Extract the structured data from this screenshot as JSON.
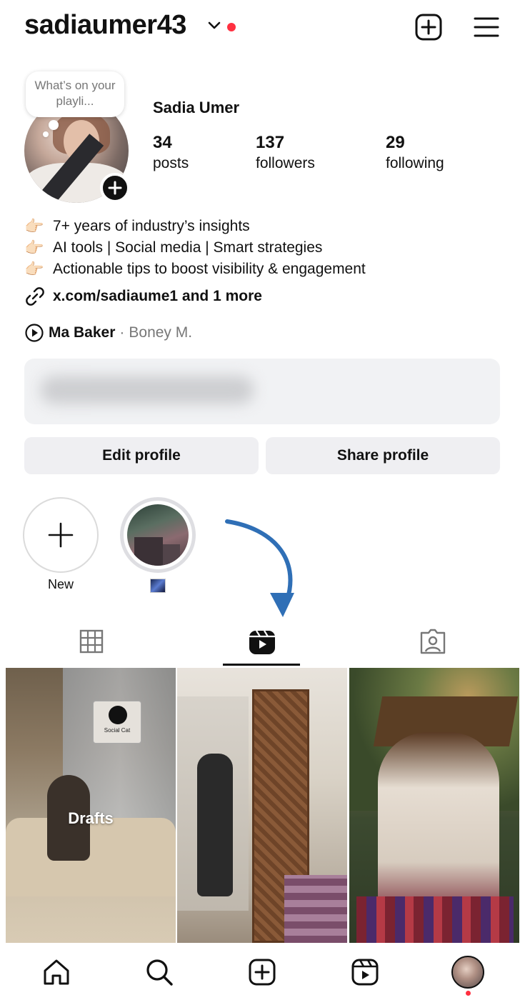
{
  "header": {
    "username": "sadiaumer43"
  },
  "profile": {
    "note": "What’s on your playli...",
    "display_name": "Sadia Umer",
    "stats": [
      {
        "value": "34",
        "label": "posts"
      },
      {
        "value": "137",
        "label": "followers"
      },
      {
        "value": "29",
        "label": "following"
      }
    ],
    "bio": [
      "7+ years of industry’s insights",
      "AI tools | Social media | Smart strategies",
      "Actionable tips to boost visibility & engagement"
    ],
    "link": "x.com/sadiaume1 and 1 more",
    "music": {
      "song": "Ma Baker",
      "separator": " · ",
      "artist": "Boney M."
    }
  },
  "buttons": {
    "edit": "Edit profile",
    "share": "Share profile"
  },
  "highlights": [
    {
      "label": "New"
    }
  ],
  "tabs": [
    "grid",
    "reels",
    "tagged"
  ],
  "active_tab": "reels",
  "grid_tiles": [
    {
      "overlay": "Drafts",
      "sign_text": "Social Cat"
    },
    {
      "overlay": ""
    },
    {
      "overlay": ""
    }
  ],
  "nav": [
    "home",
    "search",
    "create",
    "reels",
    "profile"
  ],
  "colors": {
    "accent_red": "#ff3040",
    "button_bg": "#efeff2",
    "arrow_blue": "#2f6fb6"
  }
}
